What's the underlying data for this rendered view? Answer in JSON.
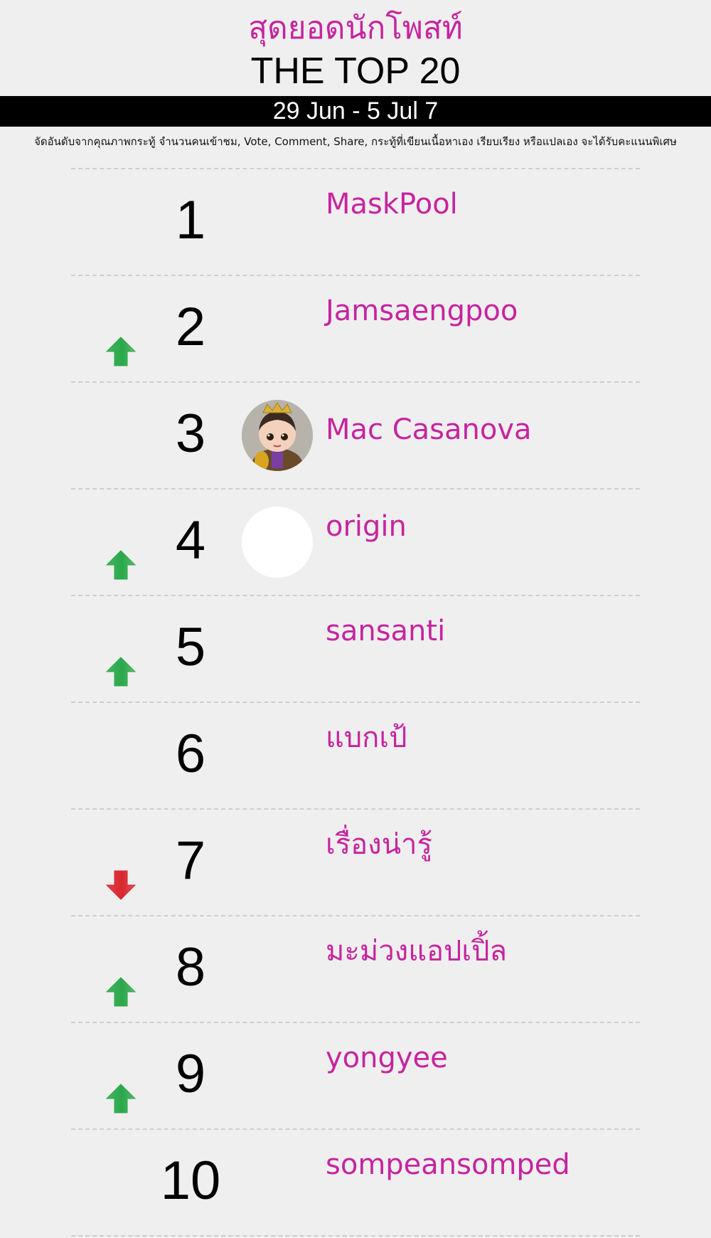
{
  "header": {
    "title_thai": "สุดยอดนักโพสท์",
    "title_en": "THE TOP 20",
    "date_range": "29 Jun - 5 Jul 7",
    "subtitle": "จัดอันดับจากคุณภาพกระทู้ จำนวนคนเข้าชม, Vote, Comment, Share, กระทู้ที่เขียนเนื้อหาเอง เรียบเรียง หรือแปลเอง จะได้รับคะแนนพิเศษ"
  },
  "colors": {
    "accent": "#c6249f",
    "up": "#2aa84a",
    "down": "#d9262e",
    "background": "#efefef"
  },
  "rankings": [
    {
      "rank": "1",
      "name": "MaskPool",
      "trend": "none",
      "avatar": "none"
    },
    {
      "rank": "2",
      "name": "Jamsaengpoo",
      "trend": "up",
      "avatar": "none"
    },
    {
      "rank": "3",
      "name": "Mac Casanova",
      "trend": "none",
      "avatar": "doll"
    },
    {
      "rank": "4",
      "name": "origin",
      "trend": "up",
      "avatar": "blank"
    },
    {
      "rank": "5",
      "name": "sansanti",
      "trend": "up",
      "avatar": "none"
    },
    {
      "rank": "6",
      "name": "แบกเป้",
      "trend": "none",
      "avatar": "none"
    },
    {
      "rank": "7",
      "name": "เรื่องน่ารู้",
      "trend": "down",
      "avatar": "none"
    },
    {
      "rank": "8",
      "name": "มะม่วงแอปเปิ้ล",
      "trend": "up",
      "avatar": "none"
    },
    {
      "rank": "9",
      "name": "yongyee",
      "trend": "up",
      "avatar": "none"
    },
    {
      "rank": "10",
      "name": "sompeansomped",
      "trend": "none",
      "avatar": "none"
    }
  ]
}
